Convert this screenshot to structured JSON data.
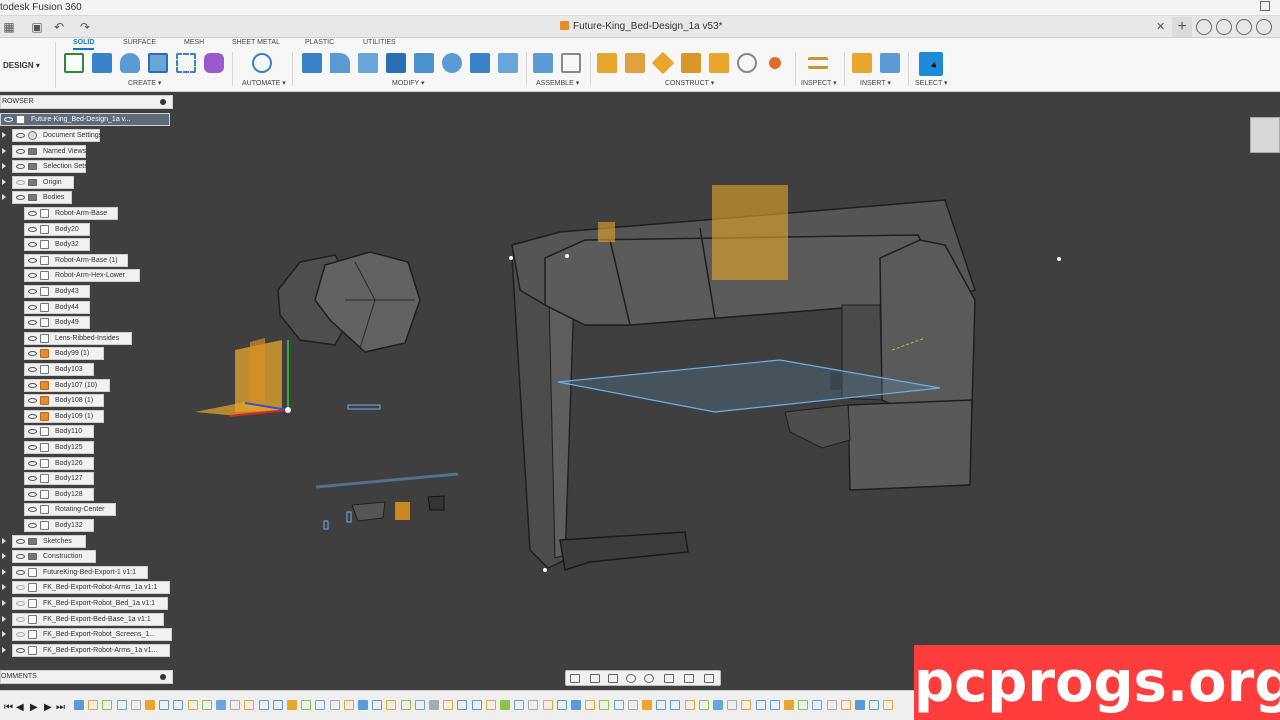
{
  "window": {
    "app_title": "todesk Fusion 360",
    "document_tab": "Future-King_Bed-Design_1a v53*"
  },
  "ribbon": {
    "workspace": "DESIGN",
    "tabs": [
      "SOLID",
      "SURFACE",
      "MESH",
      "SHEET METAL",
      "PLASTIC",
      "UTILITIES"
    ],
    "active_tab": "SOLID",
    "groups": [
      "CREATE",
      "AUTOMATE",
      "MODIFY",
      "ASSEMBLE",
      "CONSTRUCT",
      "INSPECT",
      "INSERT",
      "SELECT"
    ]
  },
  "browser": {
    "title": "ROWSER",
    "root": "Future-King_Bed-Design_1a v...",
    "items": [
      "Document Settings",
      "Named Views",
      "Selection Sets",
      "Origin",
      "Bodies",
      "Robot-Arm-Base",
      "Body20",
      "Body32",
      "Robot-Arm-Base (1)",
      "Robot-Arm-Hex-Lower",
      "Body43",
      "Body44",
      "Body49",
      "Lens-Ribbed-Insides",
      "Body99 (1)",
      "Body103",
      "Body107 (10)",
      "Body108 (1)",
      "Body109 (1)",
      "Body110",
      "Body125",
      "Body126",
      "Body127",
      "Body128",
      "Rotating-Center",
      "Body132",
      "Sketches",
      "Construction",
      "FutureKing-Bed-Export-1 v1:1",
      "FK_Bed-Export-Robot-Arms_1a v1:1",
      "FK_Bed-Export-Robot_Bed_1a v1:1",
      "FK_Bed-Export-Bed-Base_1a v1:1",
      "FK_Bed-Export-Robot_Screens_1...",
      "FK_Bed-Export-Robot-Arms_1a v1..."
    ]
  },
  "comments": {
    "title": "OMMENTS"
  },
  "watermark": "pcprogs.org",
  "colors": {
    "viewport": "#3f3f3f",
    "accent": "#1f8ad8",
    "watermark_bg": "#ff3d3d",
    "construction_plane": "#e8a62c"
  }
}
